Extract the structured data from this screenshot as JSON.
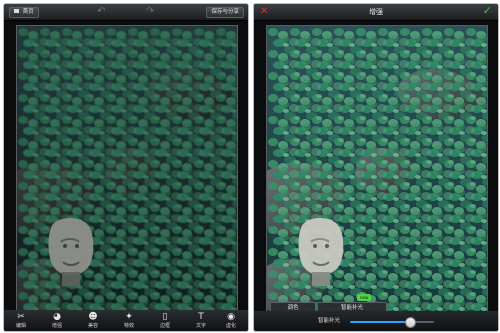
{
  "left": {
    "topbar": {
      "home_label": "首页",
      "undo_icon": "undo-arrow-icon",
      "redo_icon": "redo-arrow-icon",
      "save_share_label": "保存与分享"
    },
    "toolbar": [
      {
        "label": "编辑",
        "icon": "scissors-icon",
        "glyph": "✂"
      },
      {
        "label": "增强",
        "icon": "palette-icon",
        "glyph": "◕"
      },
      {
        "label": "美容",
        "icon": "face-icon",
        "glyph": "☻"
      },
      {
        "label": "特效",
        "icon": "magic-wand-icon",
        "glyph": "✦"
      },
      {
        "label": "边框",
        "icon": "frame-icon",
        "glyph": "▯"
      },
      {
        "label": "文字",
        "icon": "text-icon",
        "glyph": "T"
      },
      {
        "label": "虚化",
        "icon": "blur-icon",
        "glyph": "◉"
      }
    ]
  },
  "right": {
    "topbar": {
      "title": "增强",
      "close_icon": "close-icon",
      "confirm_icon": "check-icon"
    },
    "modes": [
      {
        "label": "调色"
      },
      {
        "label": "智能补光"
      }
    ],
    "new_badge": "new",
    "slider": {
      "label": "智能补光",
      "value_fraction": 0.72
    }
  },
  "colors": {
    "accent_blue": "#2aa2ff",
    "close_red": "#d23a2d",
    "confirm_green": "#43c33c",
    "badge_green": "#54d14a"
  }
}
